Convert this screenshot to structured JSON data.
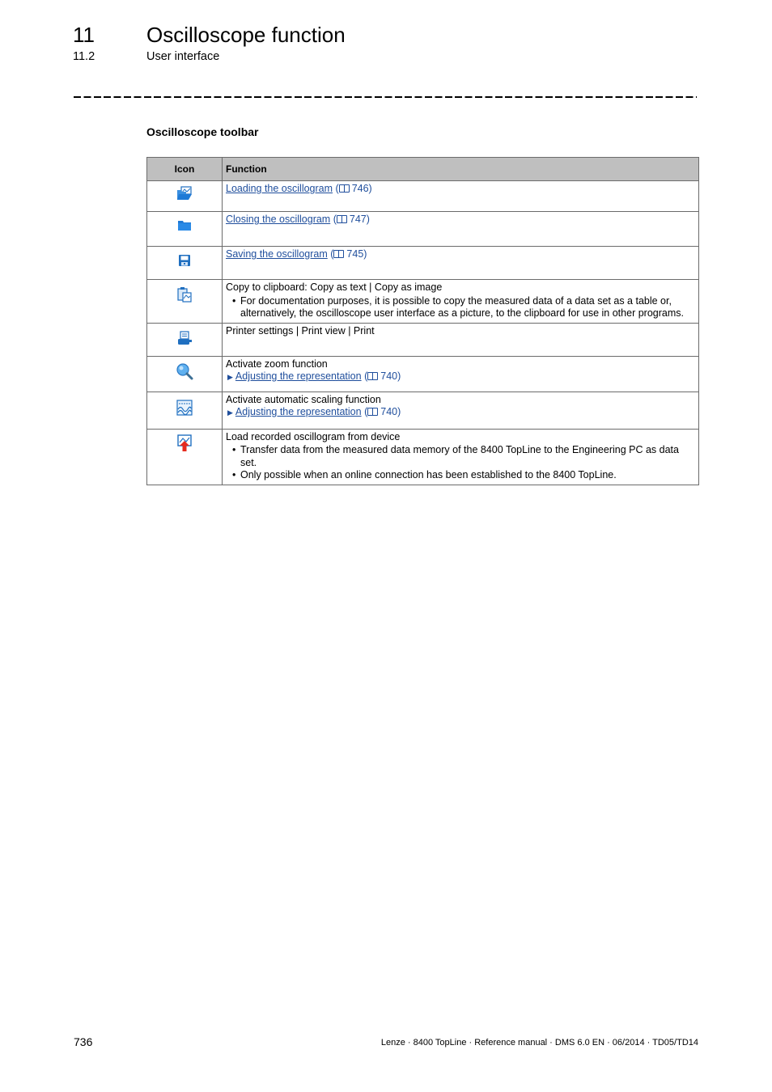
{
  "header": {
    "chapter_number": "11",
    "chapter_title": "Oscilloscope function",
    "section_number": "11.2",
    "section_title": "User interface"
  },
  "section_heading": "Oscilloscope toolbar",
  "table": {
    "columns": [
      "Icon",
      "Function"
    ],
    "rows": [
      {
        "icon": "open-folder-icon",
        "link": "Loading the oscillogram",
        "page": "746"
      },
      {
        "icon": "closed-folder-icon",
        "link": "Closing the oscillogram",
        "page": "747"
      },
      {
        "icon": "floppy-disk-icon",
        "link": "Saving the oscillogram",
        "page": "745"
      },
      {
        "icon": "clipboard-icon",
        "text": "Copy to clipboard: Copy as text | Copy as image",
        "bullets": [
          "For documentation purposes, it is possible to copy the measured data of a data set as a table or, alternatively, the oscilloscope user interface as a picture, to the clipboard for use in other programs."
        ]
      },
      {
        "icon": "printer-icon",
        "text": "Printer settings | Print view | Print"
      },
      {
        "icon": "magnifier-icon",
        "text": "Activate zoom function",
        "link": "Adjusting the representation",
        "page": "740"
      },
      {
        "icon": "auto-scale-icon",
        "text": "Activate automatic scaling function",
        "link": "Adjusting the representation",
        "page": "740"
      },
      {
        "icon": "upload-from-device-icon",
        "text": "Load recorded oscillogram from device",
        "bullets": [
          "Transfer data from the measured data memory of the 8400 TopLine to the Engineering PC as data set.",
          "Only possible when an online connection has been established to the 8400 TopLine."
        ]
      }
    ]
  },
  "footer": {
    "page_number": "736",
    "info": "Lenze · 8400 TopLine · Reference manual · DMS 6.0 EN · 06/2014 · TD05/TD14"
  },
  "colors": {
    "link": "#1f4e9c",
    "header_bg": "#bfbfbf",
    "icon_blue": "#1f7ad6",
    "icon_red": "#e52a1e"
  }
}
